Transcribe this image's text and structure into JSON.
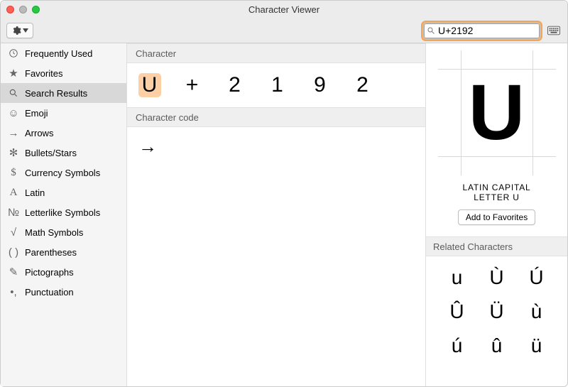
{
  "window": {
    "title": "Character Viewer"
  },
  "toolbar": {
    "search_value": "U+2192"
  },
  "sidebar": {
    "items": [
      {
        "label": "Frequently Used",
        "icon": "clock"
      },
      {
        "label": "Favorites",
        "icon": "star"
      },
      {
        "label": "Search Results",
        "icon": "magnifier",
        "selected": true
      },
      {
        "label": "Emoji",
        "icon": "smile"
      },
      {
        "label": "Arrows",
        "icon": "arrow"
      },
      {
        "label": "Bullets/Stars",
        "icon": "asterisk"
      },
      {
        "label": "Currency Symbols",
        "icon": "dollar"
      },
      {
        "label": "Latin",
        "icon": "latin"
      },
      {
        "label": "Letterlike Symbols",
        "icon": "no"
      },
      {
        "label": "Math Symbols",
        "icon": "sqrt"
      },
      {
        "label": "Parentheses",
        "icon": "parens"
      },
      {
        "label": "Pictographs",
        "icon": "picto"
      },
      {
        "label": "Punctuation",
        "icon": "punct"
      }
    ]
  },
  "main": {
    "character_header": "Character",
    "character_chars": [
      "U",
      "+",
      "2",
      "1",
      "9",
      "2"
    ],
    "code_header": "Character code",
    "code_glyph": "→"
  },
  "detail": {
    "glyph": "U",
    "name_line1": "LATIN CAPITAL",
    "name_line2": "LETTER U",
    "add_favorites_label": "Add to Favorites",
    "related_header": "Related Characters",
    "related": [
      "u",
      "Ù",
      "Ú",
      "Û",
      "Ü",
      "ù",
      "ú",
      "û",
      "ü"
    ]
  }
}
